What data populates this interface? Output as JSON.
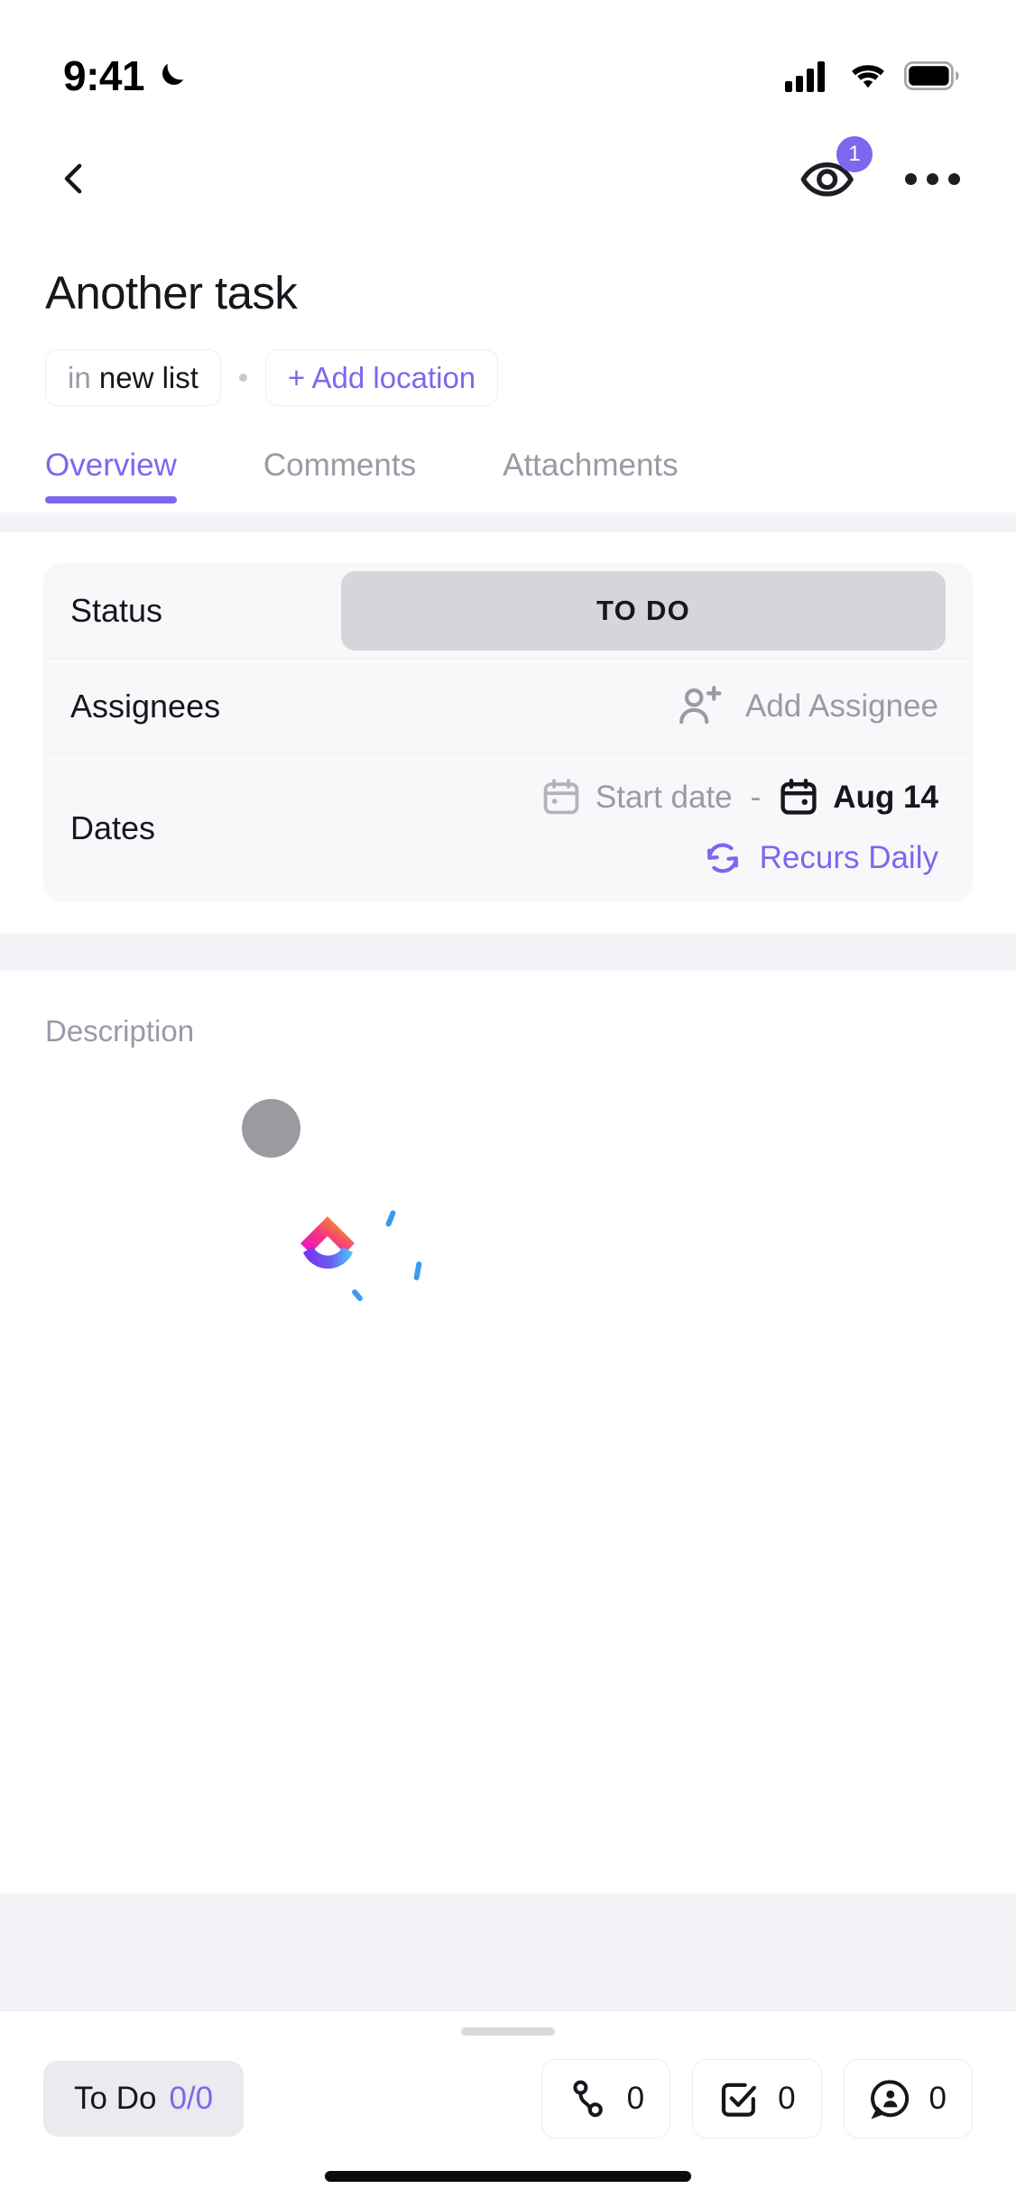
{
  "status_bar": {
    "time": "9:41",
    "dnd_icon": "crescent-moon-icon",
    "cellular_icon": "signal-bars-icon",
    "wifi_icon": "wifi-icon",
    "battery_icon": "battery-full-icon"
  },
  "nav": {
    "back_icon": "chevron-left-icon",
    "watchers_icon": "eye-icon",
    "watchers_count": "1",
    "more_icon": "more-horizontal-icon"
  },
  "task": {
    "title": "Another task",
    "location_prefix": "in",
    "location_name": "new list",
    "add_location_label": "+ Add location"
  },
  "tabs": [
    {
      "label": "Overview",
      "active": true
    },
    {
      "label": "Comments",
      "active": false
    },
    {
      "label": "Attachments",
      "active": false
    }
  ],
  "fields": {
    "status": {
      "label": "Status",
      "value": "TO DO",
      "pill_color": "#d6d6da"
    },
    "assignees": {
      "label": "Assignees",
      "add_label": "Add Assignee",
      "add_icon": "person-plus-icon"
    },
    "dates": {
      "label": "Dates",
      "start_icon": "calendar-icon",
      "start_placeholder": "Start date",
      "separator": "-",
      "due_icon": "calendar-filled-icon",
      "due_value": "Aug 14",
      "recur_icon": "refresh-icon",
      "recur_label": "Recurs Daily"
    }
  },
  "description": {
    "label": "Description",
    "loading_logo": "clickup-logo-icon"
  },
  "bottom_bar": {
    "todo_label": "To Do",
    "todo_count": "0/0",
    "actions": [
      {
        "icon": "dependency-icon",
        "count": "0"
      },
      {
        "icon": "subtask-checkbox-icon",
        "count": "0"
      },
      {
        "icon": "comment-person-icon",
        "count": "0"
      }
    ]
  },
  "colors": {
    "accent": "#7B68EE",
    "muted_text": "#9a9aa6",
    "primary_text": "#16161d",
    "band": "#f4f4f8",
    "card": "#f8f8fb"
  }
}
